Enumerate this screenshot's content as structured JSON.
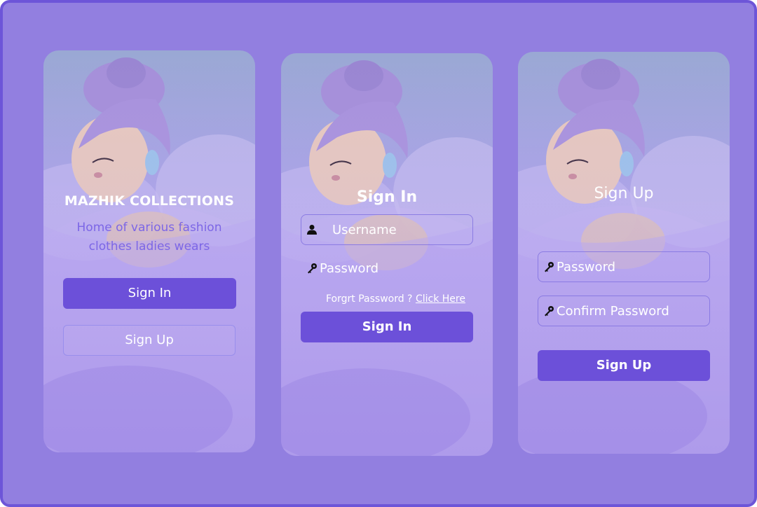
{
  "colors": {
    "background": "#927fe0",
    "border": "#6d55d8",
    "accent": "#6c50d9",
    "subtitle": "#7c66e6"
  },
  "screens": {
    "welcome": {
      "title": "MAZHIK COLLECTIONS",
      "subtitle_line1": "Home of various fashion",
      "subtitle_line2": "clothes ladies wears",
      "signin_label": "Sign In",
      "signup_label": "Sign Up"
    },
    "signin": {
      "title": "Sign In",
      "username_placeholder": "Username",
      "password_placeholder": "Password",
      "forgot_text": "Forgrt Password ?",
      "forgot_link": "Click Here",
      "submit_label": "Sign In",
      "icons": [
        "user-icon",
        "key-icon"
      ]
    },
    "signup": {
      "title": "Sign Up",
      "password_placeholder": "Password",
      "confirm_placeholder": "Confirm Password",
      "submit_label": "Sign Up",
      "icons": [
        "key-icon"
      ]
    }
  }
}
